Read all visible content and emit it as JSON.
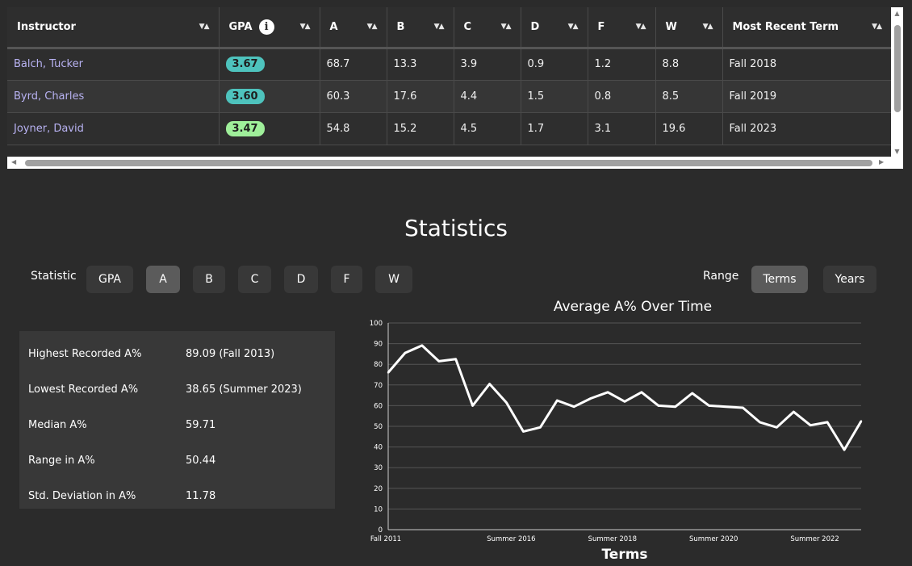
{
  "table": {
    "columns": [
      {
        "key": "instructor",
        "label": "Instructor"
      },
      {
        "key": "gpa",
        "label": "GPA",
        "info": true
      },
      {
        "key": "a",
        "label": "A"
      },
      {
        "key": "b",
        "label": "B"
      },
      {
        "key": "c",
        "label": "C"
      },
      {
        "key": "d",
        "label": "D"
      },
      {
        "key": "f",
        "label": "F"
      },
      {
        "key": "w",
        "label": "W"
      },
      {
        "key": "term",
        "label": "Most Recent Term"
      }
    ],
    "sort_icon": "sort-arrows-icon",
    "info_icon": "info-icon",
    "info_glyph": "i",
    "rows": [
      {
        "instructor": "Balch, Tucker",
        "gpa": "3.67",
        "gpa_color": "#4ec3bd",
        "a": "68.7",
        "b": "13.3",
        "c": "3.9",
        "d": "0.9",
        "f": "1.2",
        "w": "8.8",
        "term": "Fall 2018"
      },
      {
        "instructor": "Byrd, Charles",
        "gpa": "3.60",
        "gpa_color": "#4ec3bd",
        "a": "60.3",
        "b": "17.6",
        "c": "4.4",
        "d": "1.5",
        "f": "0.8",
        "w": "8.5",
        "term": "Fall 2019"
      },
      {
        "instructor": "Joyner, David",
        "gpa": "3.47",
        "gpa_color": "#9fef9a",
        "a": "54.8",
        "b": "15.2",
        "c": "4.5",
        "d": "1.7",
        "f": "3.1",
        "w": "19.6",
        "term": "Fall 2023"
      }
    ]
  },
  "statistics": {
    "title": "Statistics",
    "statistic_label": "Statistic",
    "statistic_options": [
      "GPA",
      "A",
      "B",
      "C",
      "D",
      "F",
      "W"
    ],
    "statistic_selected": "A",
    "range_label": "Range",
    "range_options": [
      "Terms",
      "Years"
    ],
    "range_selected": "Terms",
    "summary": [
      {
        "label": "Highest Recorded A%",
        "value": "89.09 (Fall 2013)"
      },
      {
        "label": "Lowest Recorded A%",
        "value": "38.65 (Summer 2023)"
      },
      {
        "label": "Median A%",
        "value": "59.71"
      },
      {
        "label": "Range in A%",
        "value": "50.44"
      },
      {
        "label": "Std. Deviation in A%",
        "value": "11.78"
      }
    ]
  },
  "chart_data": {
    "type": "line",
    "title": "Average A% Over Time",
    "xlabel": "Terms",
    "ylabel": "",
    "ylim": [
      0,
      100
    ],
    "yticks": [
      0,
      10,
      20,
      30,
      40,
      50,
      60,
      70,
      80,
      90,
      100
    ],
    "xtick_labels": [
      "Fall 2011",
      "Summer 2016",
      "Summer 2018",
      "Summer 2020",
      "Summer 2022"
    ],
    "grid": true,
    "line_color": "#ffffff",
    "values": [
      76,
      85.5,
      89.09,
      81.5,
      82.5,
      60,
      70.5,
      61.5,
      47.5,
      49.5,
      62.5,
      59.5,
      63.5,
      66.5,
      62,
      66.5,
      60,
      59.5,
      66,
      60,
      59.5,
      59,
      52,
      49.5,
      57,
      50.5,
      52,
      38.65,
      52.5
    ]
  }
}
